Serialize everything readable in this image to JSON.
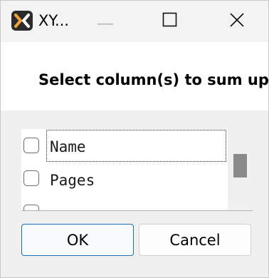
{
  "window": {
    "title": "XY...",
    "app_icon": "app-logo-icon",
    "controls": {
      "minimize_icon": "minimize-icon",
      "maximize_icon": "maximize-icon",
      "close_icon": "close-icon"
    }
  },
  "dialog": {
    "prompt": "Select column(s) to sum up",
    "columns": [
      {
        "label": "Name",
        "checked": false,
        "focused": true
      },
      {
        "label": "Pages",
        "checked": false,
        "focused": false
      },
      {
        "label": "",
        "checked": false,
        "focused": false
      }
    ],
    "ok_label": "OK",
    "cancel_label": "Cancel"
  },
  "colors": {
    "accent": "#1a6fb8",
    "titlebar_bg": "#f3f3f3",
    "body_bg": "#f0f0f0"
  }
}
